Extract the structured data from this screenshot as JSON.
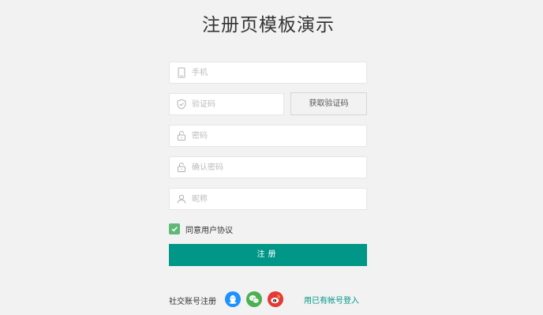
{
  "page": {
    "title": "注册页模板演示"
  },
  "form": {
    "phone": {
      "placeholder": "手机",
      "value": "",
      "icon": "cellphone-icon"
    },
    "code": {
      "placeholder": "验证码",
      "value": "",
      "icon": "shield-icon"
    },
    "get_code_label": "获取验证码",
    "password": {
      "placeholder": "密码",
      "value": "",
      "icon": "lock-icon"
    },
    "confirm_password": {
      "placeholder": "确认密码",
      "value": "",
      "icon": "lock-icon"
    },
    "nickname": {
      "placeholder": "昵称",
      "value": "",
      "icon": "user-icon"
    },
    "agree_label": "同意用户协议",
    "agree_checked": true,
    "submit_label": "注册"
  },
  "social": {
    "label": "社交账号注册",
    "icons": [
      "qq-icon",
      "wechat-icon",
      "weibo-icon"
    ],
    "login_link": "用已有帐号登入"
  },
  "colors": {
    "primary": "#009688",
    "checkbox": "#5fb878",
    "qq": "#1e90ff",
    "wechat": "#4caf50",
    "weibo": "#e53935",
    "background": "#f2f2f2"
  }
}
